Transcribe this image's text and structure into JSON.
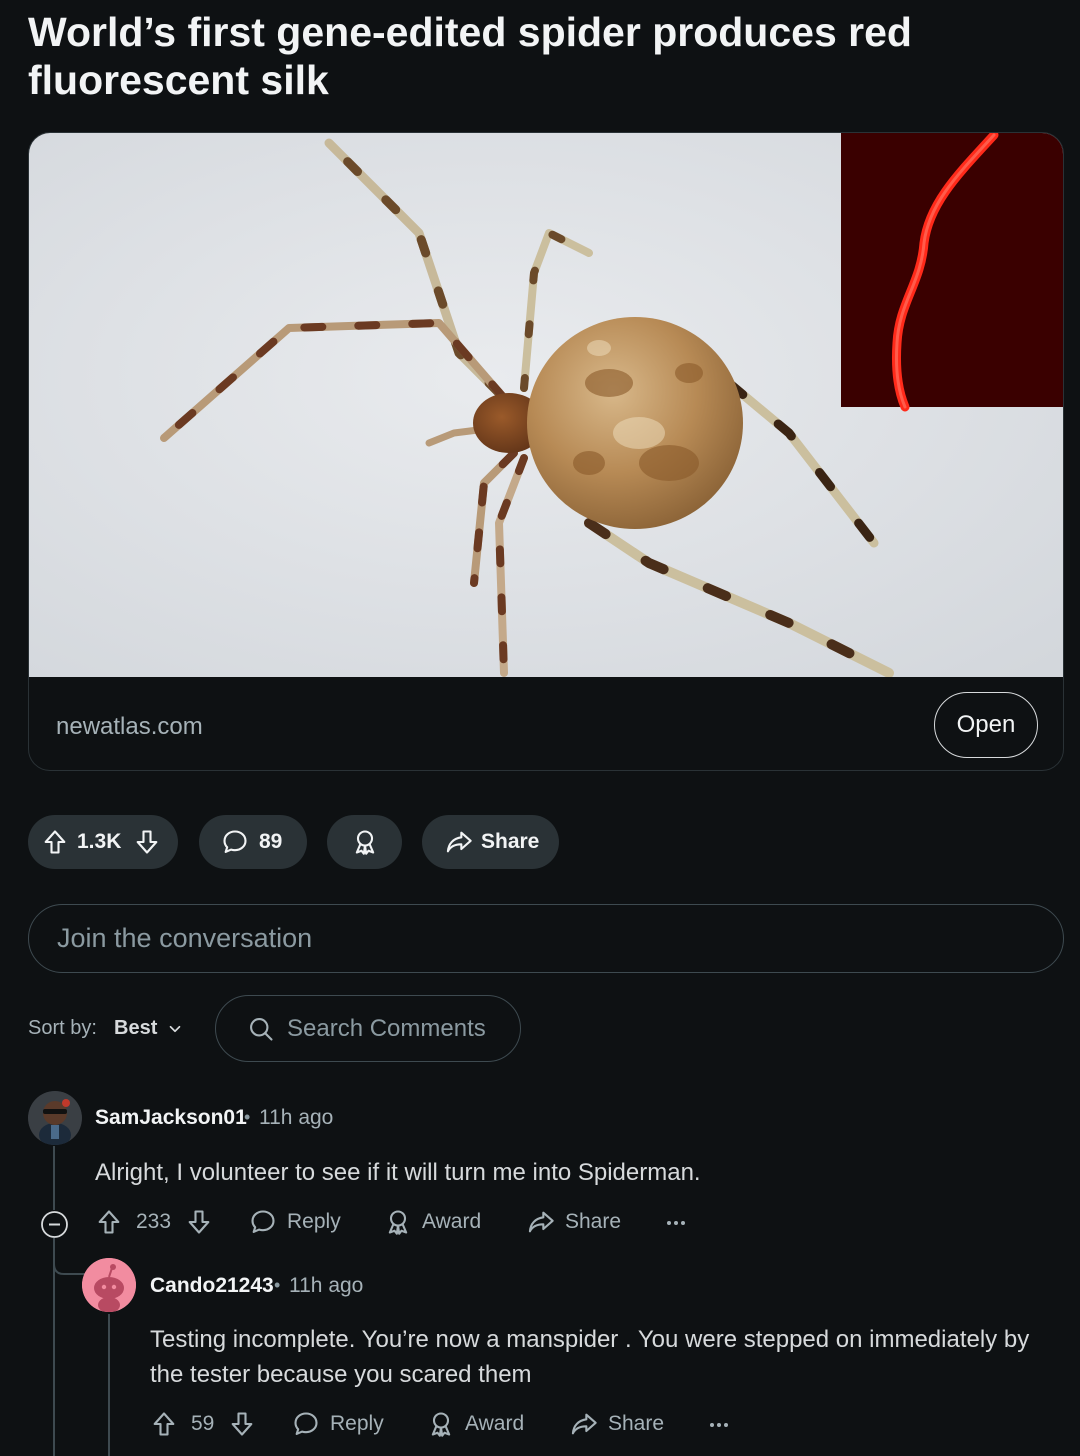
{
  "post": {
    "title": "World’s first gene-edited spider produces red fluorescent silk",
    "link_domain": "newatlas.com",
    "open_label": "Open",
    "votes": "1.3K",
    "comments": "89",
    "share_label": "Share"
  },
  "composer": {
    "placeholder": "Join the conversation"
  },
  "sort": {
    "label": "Sort by:",
    "value": "Best"
  },
  "search": {
    "placeholder": "Search Comments"
  },
  "comments": [
    {
      "user": "SamJackson01",
      "time": "11h ago",
      "text": "Alright, I volunteer to see if it will turn me into Spiderman.",
      "votes": "233",
      "reply_label": "Reply",
      "award_label": "Award",
      "share_label": "Share"
    },
    {
      "user": "Cando21243",
      "time": "11h ago",
      "text": "Testing incomplete. You’re now a manspider . You were stepped on immediately by the tester because you scared them",
      "votes": "59",
      "reply_label": "Reply",
      "award_label": "Award",
      "share_label": "Share"
    }
  ],
  "colors": {
    "background": "#0e1113",
    "pill": "#2a3236",
    "border": "#3e4a50",
    "muted_text": "#a6b2b8",
    "silk_red": "#ff1a1a",
    "silk_bg": "#3a0000",
    "avatar_pink": "#f28ca0"
  },
  "icons": [
    "upvote-icon",
    "downvote-icon",
    "comment-icon",
    "award-icon",
    "share-icon",
    "search-icon",
    "chevron-down-icon",
    "collapse-icon",
    "more-icon"
  ]
}
